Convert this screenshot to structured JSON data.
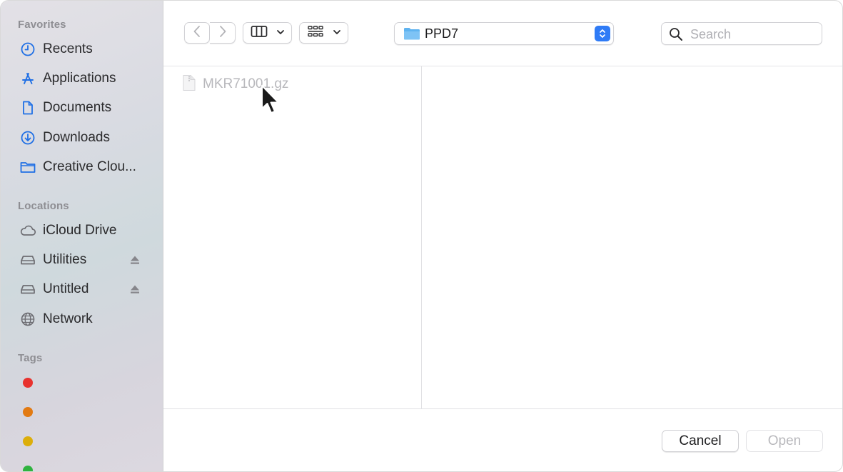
{
  "sidebar": {
    "favorites_title": "Favorites",
    "favorites": [
      {
        "label": "Recents",
        "icon": "clock-icon"
      },
      {
        "label": "Applications",
        "icon": "applications-icon"
      },
      {
        "label": "Documents",
        "icon": "document-icon"
      },
      {
        "label": "Downloads",
        "icon": "download-icon"
      },
      {
        "label": "Creative Clou...",
        "icon": "folder-icon"
      }
    ],
    "locations_title": "Locations",
    "locations": [
      {
        "label": "iCloud Drive",
        "icon": "cloud-icon"
      },
      {
        "label": "Utilities",
        "icon": "drive-icon",
        "ejectable": true
      },
      {
        "label": "Untitled",
        "icon": "drive-icon",
        "ejectable": true
      },
      {
        "label": "Network",
        "icon": "globe-icon"
      }
    ],
    "tags_title": "Tags",
    "tags": [
      {
        "color": "#e8322e"
      },
      {
        "color": "#e27a12"
      },
      {
        "color": "#dcae0a"
      },
      {
        "color": "#2fb33f"
      }
    ]
  },
  "toolbar": {
    "back_icon": "chevron-left-icon",
    "forward_icon": "chevron-right-icon",
    "view_mode_icon": "column-view-icon",
    "group_icon": "grid-group-icon",
    "path": {
      "label": "PPD7",
      "icon": "folder-icon"
    },
    "search": {
      "placeholder": "Search",
      "value": ""
    }
  },
  "browser": {
    "files": [
      {
        "name": "MKR71001.gz",
        "icon": "file-icon",
        "disabled": true
      }
    ]
  },
  "actions": {
    "cancel_label": "Cancel",
    "open_label": "Open"
  },
  "colors": {
    "accent": "#2f7bf6",
    "sidebar_icon": "#1f6fe5",
    "disabled_text": "#b8b8bc"
  }
}
